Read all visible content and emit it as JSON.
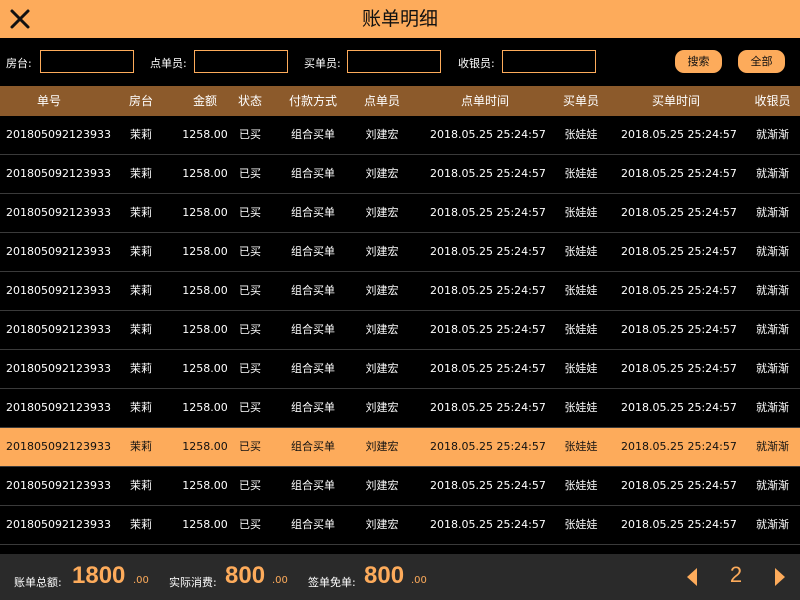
{
  "header": {
    "title": "账单明细",
    "close_icon": "close-icon"
  },
  "filters": {
    "room_label": "房台:",
    "room_value": "",
    "orderer_label": "点单员:",
    "orderer_value": "",
    "buyer_label": "买单员:",
    "buyer_value": "",
    "cashier_label": "收银员:",
    "cashier_value": "",
    "search_label": "搜索",
    "all_label": "全部"
  },
  "table": {
    "columns": [
      "单号",
      "房台",
      "金额",
      "状态",
      "付款方式",
      "点单员",
      "点单时间",
      "买单员",
      "买单时间",
      "收银员"
    ],
    "selected_row": 8,
    "rows": [
      [
        "201805092123933",
        "茉莉",
        "1258.00",
        "已买",
        "组合买单",
        "刘建宏",
        "2018.05.25 25:24:57",
        "张娃娃",
        "2018.05.25 25:24:57",
        "就渐渐"
      ],
      [
        "201805092123933",
        "茉莉",
        "1258.00",
        "已买",
        "组合买单",
        "刘建宏",
        "2018.05.25 25:24:57",
        "张娃娃",
        "2018.05.25 25:24:57",
        "就渐渐"
      ],
      [
        "201805092123933",
        "茉莉",
        "1258.00",
        "已买",
        "组合买单",
        "刘建宏",
        "2018.05.25 25:24:57",
        "张娃娃",
        "2018.05.25 25:24:57",
        "就渐渐"
      ],
      [
        "201805092123933",
        "茉莉",
        "1258.00",
        "已买",
        "组合买单",
        "刘建宏",
        "2018.05.25 25:24:57",
        "张娃娃",
        "2018.05.25 25:24:57",
        "就渐渐"
      ],
      [
        "201805092123933",
        "茉莉",
        "1258.00",
        "已买",
        "组合买单",
        "刘建宏",
        "2018.05.25 25:24:57",
        "张娃娃",
        "2018.05.25 25:24:57",
        "就渐渐"
      ],
      [
        "201805092123933",
        "茉莉",
        "1258.00",
        "已买",
        "组合买单",
        "刘建宏",
        "2018.05.25 25:24:57",
        "张娃娃",
        "2018.05.25 25:24:57",
        "就渐渐"
      ],
      [
        "201805092123933",
        "茉莉",
        "1258.00",
        "已买",
        "组合买单",
        "刘建宏",
        "2018.05.25 25:24:57",
        "张娃娃",
        "2018.05.25 25:24:57",
        "就渐渐"
      ],
      [
        "201805092123933",
        "茉莉",
        "1258.00",
        "已买",
        "组合买单",
        "刘建宏",
        "2018.05.25 25:24:57",
        "张娃娃",
        "2018.05.25 25:24:57",
        "就渐渐"
      ],
      [
        "201805092123933",
        "茉莉",
        "1258.00",
        "已买",
        "组合买单",
        "刘建宏",
        "2018.05.25 25:24:57",
        "张娃娃",
        "2018.05.25 25:24:57",
        "就渐渐"
      ],
      [
        "201805092123933",
        "茉莉",
        "1258.00",
        "已买",
        "组合买单",
        "刘建宏",
        "2018.05.25 25:24:57",
        "张娃娃",
        "2018.05.25 25:24:57",
        "就渐渐"
      ],
      [
        "201805092123933",
        "茉莉",
        "1258.00",
        "已买",
        "组合买单",
        "刘建宏",
        "2018.05.25 25:24:57",
        "张娃娃",
        "2018.05.25 25:24:57",
        "就渐渐"
      ]
    ]
  },
  "summary": {
    "total_label": "账单总额:",
    "total_int": "1800",
    "total_dec": ".00",
    "actual_label": "实际消费:",
    "actual_int": "800",
    "actual_dec": ".00",
    "free_label": "签单免单:",
    "free_int": "800",
    "free_dec": ".00"
  },
  "pager": {
    "current_page": "2",
    "prev_icon": "caret-left-icon",
    "next_icon": "caret-right-icon"
  },
  "colors": {
    "accent": "#fdab5b",
    "header_row": "#8c5a2b",
    "background": "#000000",
    "footer": "#2a2a2a"
  }
}
